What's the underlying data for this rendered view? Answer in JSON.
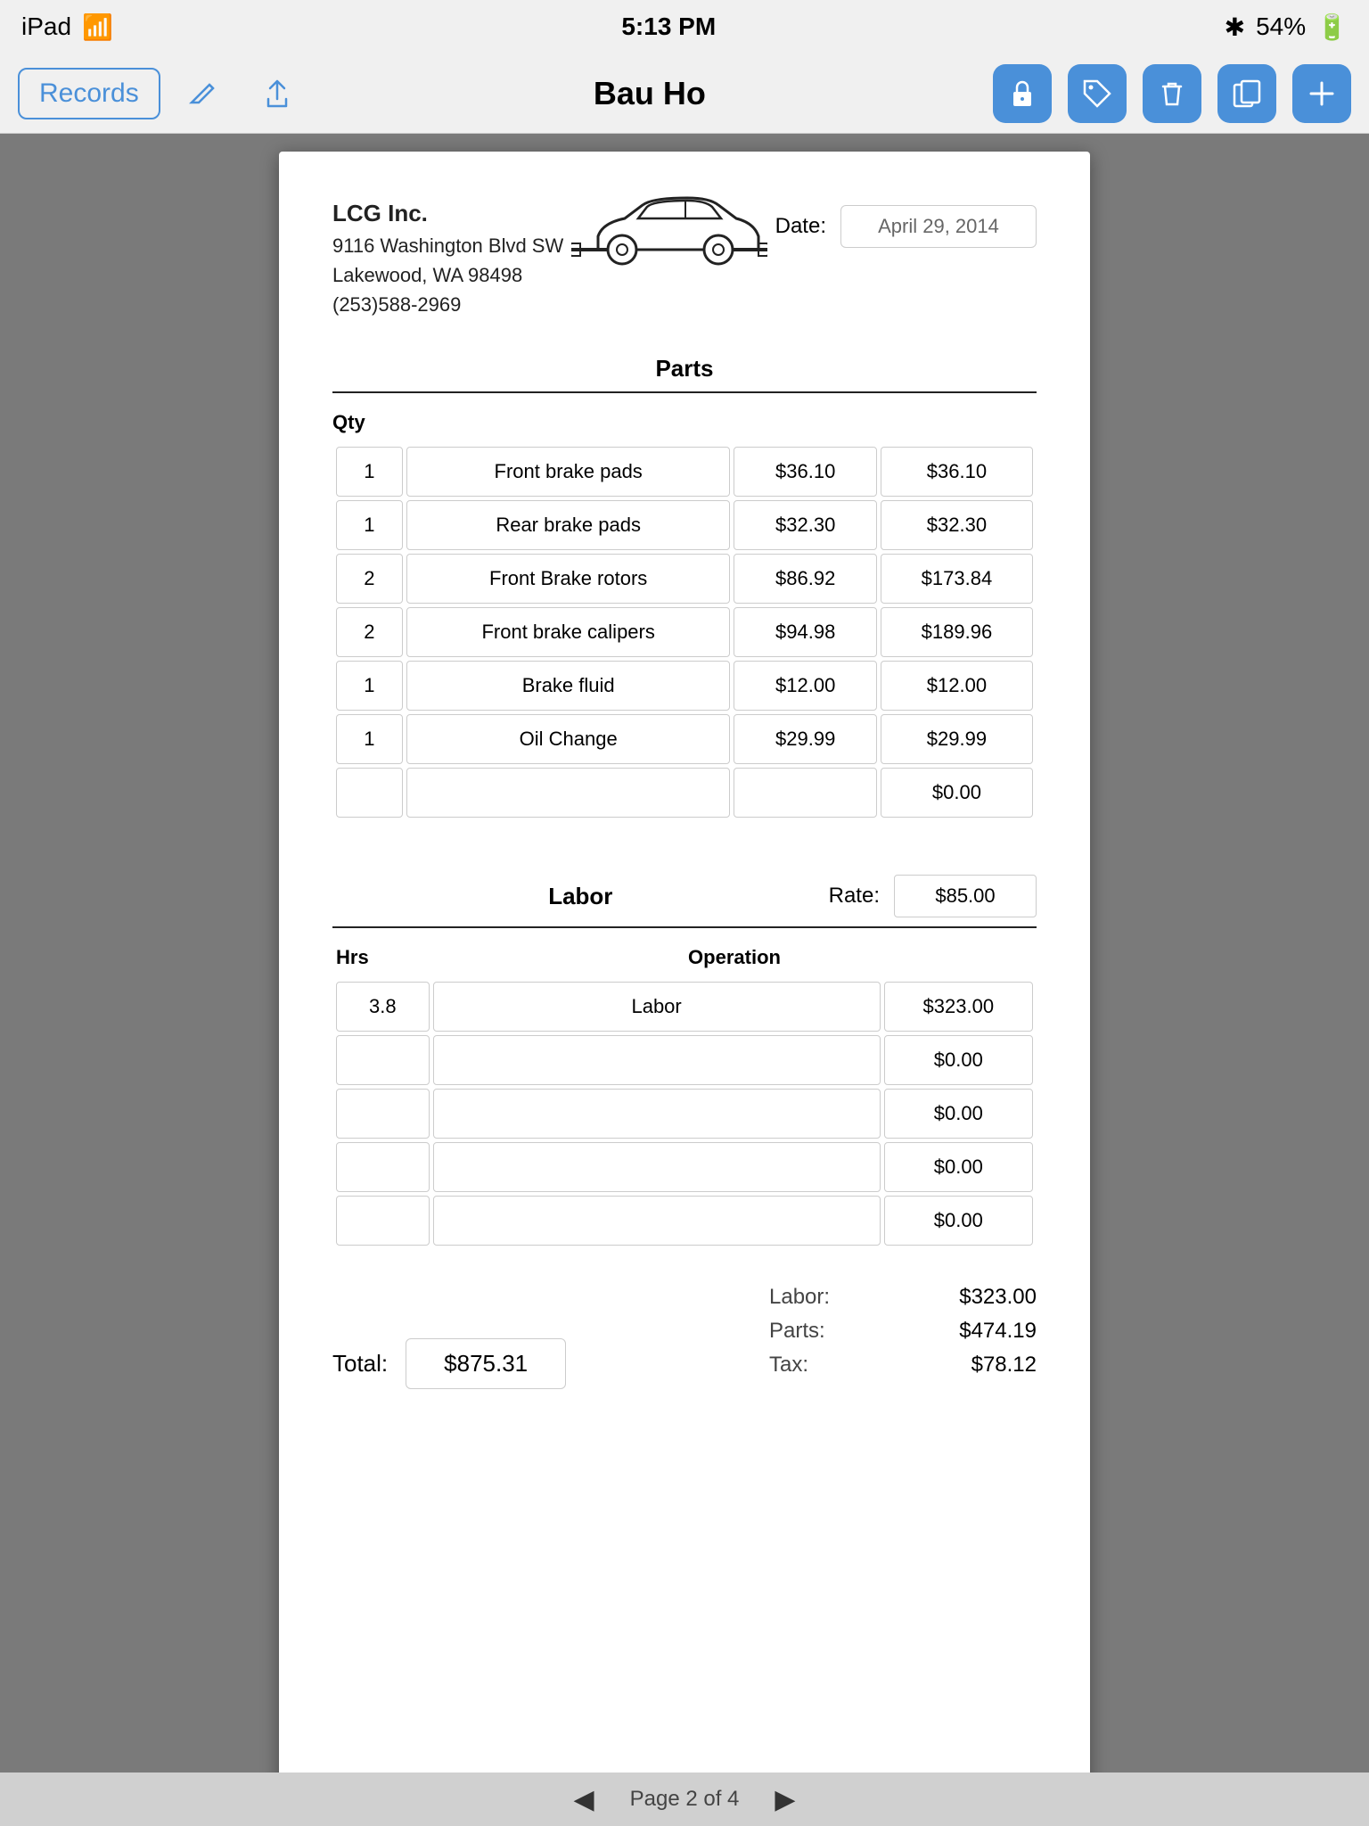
{
  "statusBar": {
    "left": "iPad",
    "time": "5:13 PM",
    "bluetooth": "BT",
    "battery": "54%"
  },
  "toolbar": {
    "records_label": "Records",
    "title": "Bau Ho"
  },
  "document": {
    "company": {
      "name": "LCG Inc.",
      "address1": "9116 Washington Blvd SW",
      "address2": "Lakewood, WA  98498",
      "phone": "(253)588-2969"
    },
    "date_label": "Date:",
    "date_value": "April 29, 2014",
    "parts": {
      "section_title": "Parts",
      "qty_label": "Qty",
      "rows": [
        {
          "qty": "1",
          "name": "Front brake pads",
          "price": "$36.10",
          "total": "$36.10"
        },
        {
          "qty": "1",
          "name": "Rear brake pads",
          "price": "$32.30",
          "total": "$32.30"
        },
        {
          "qty": "2",
          "name": "Front Brake rotors",
          "price": "$86.92",
          "total": "$173.84"
        },
        {
          "qty": "2",
          "name": "Front brake calipers",
          "price": "$94.98",
          "total": "$189.96"
        },
        {
          "qty": "1",
          "name": "Brake fluid",
          "price": "$12.00",
          "total": "$12.00"
        },
        {
          "qty": "1",
          "name": "Oil Change",
          "price": "$29.99",
          "total": "$29.99"
        },
        {
          "qty": "",
          "name": "",
          "price": "",
          "total": "$0.00"
        }
      ]
    },
    "labor": {
      "section_title": "Labor",
      "rate_label": "Rate:",
      "rate_value": "$85.00",
      "hrs_label": "Hrs",
      "op_label": "Operation",
      "rows": [
        {
          "hrs": "3.8",
          "operation": "Labor",
          "amount": "$323.00"
        },
        {
          "hrs": "",
          "operation": "",
          "amount": "$0.00"
        },
        {
          "hrs": "",
          "operation": "",
          "amount": "$0.00"
        },
        {
          "hrs": "",
          "operation": "",
          "amount": "$0.00"
        },
        {
          "hrs": "",
          "operation": "",
          "amount": "$0.00"
        }
      ]
    },
    "totals": {
      "total_label": "Total:",
      "total_value": "$875.31",
      "labor_label": "Labor:",
      "labor_value": "$323.00",
      "parts_label": "Parts:",
      "parts_value": "$474.19",
      "tax_label": "Tax:",
      "tax_value": "$78.12"
    }
  },
  "pageIndicator": {
    "text": "Page 2 of 4"
  }
}
